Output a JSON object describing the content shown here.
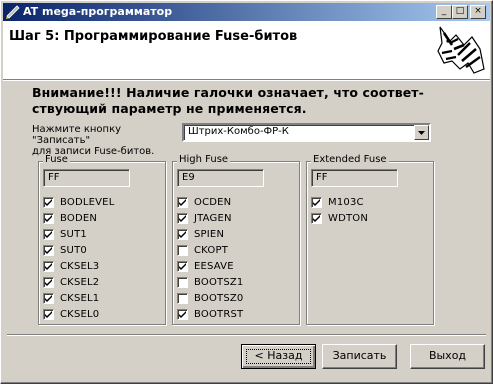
{
  "window": {
    "title": "AT mega-программатор",
    "minimize_glyph": "_",
    "maximize_glyph": "□",
    "close_glyph": "×"
  },
  "header": {
    "step_title": "Шаг 5: Программирование Fuse-битов",
    "logo": "zebra-logo"
  },
  "warning": {
    "line1": "Внимание!!! Наличие галочки означает, что соответ-",
    "line2": "ствующий параметр не применяется."
  },
  "hint": {
    "line1": "Нажмите кнопку \"Записать\"",
    "line2": "для записи Fuse-битов."
  },
  "device_select": {
    "value": "Штрих-Комбо-ФР-К"
  },
  "groups": {
    "fuse": {
      "label": "Fuse",
      "value": "FF",
      "bits": [
        {
          "name": "BODLEVEL",
          "checked": true
        },
        {
          "name": "BODEN",
          "checked": true
        },
        {
          "name": "SUT1",
          "checked": true
        },
        {
          "name": "SUT0",
          "checked": true
        },
        {
          "name": "CKSEL3",
          "checked": true
        },
        {
          "name": "CKSEL2",
          "checked": true
        },
        {
          "name": "CKSEL1",
          "checked": true
        },
        {
          "name": "CKSEL0",
          "checked": true
        }
      ]
    },
    "high": {
      "label": "High Fuse",
      "value": "E9",
      "bits": [
        {
          "name": "OCDEN",
          "checked": true
        },
        {
          "name": "JTAGEN",
          "checked": true
        },
        {
          "name": "SPIEN",
          "checked": true
        },
        {
          "name": "CKOPT",
          "checked": false
        },
        {
          "name": "EESAVE",
          "checked": true
        },
        {
          "name": "BOOTSZ1",
          "checked": false
        },
        {
          "name": "BOOTSZ0",
          "checked": false
        },
        {
          "name": "BOOTRST",
          "checked": true
        }
      ]
    },
    "extended": {
      "label": "Extended Fuse",
      "value": "FF",
      "bits": [
        {
          "name": "M103C",
          "checked": true
        },
        {
          "name": "WDTON",
          "checked": true
        }
      ]
    }
  },
  "buttons": {
    "back": "< Назад",
    "write": "Записать",
    "exit": "Выход"
  },
  "colors": {
    "titlebar_start": "#0a246a",
    "titlebar_end": "#a6caf0",
    "face": "#d4d0c8"
  }
}
